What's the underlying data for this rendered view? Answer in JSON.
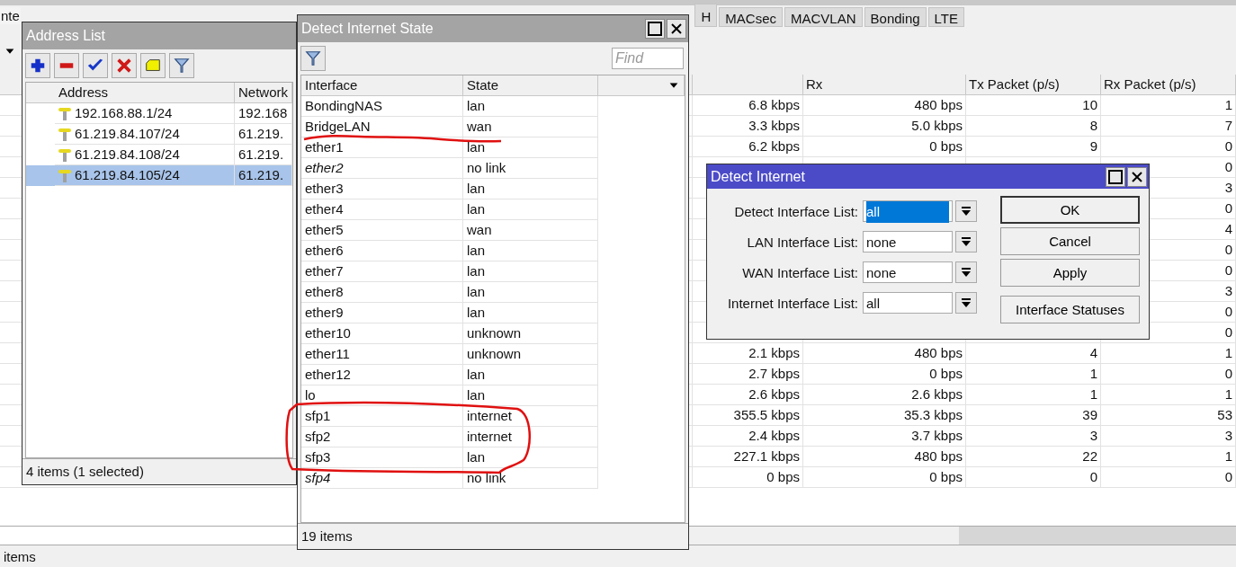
{
  "main_window": {
    "tabs": [
      {
        "label": "nte",
        "selected": true
      },
      {
        "label": "H",
        "selected": false
      },
      {
        "label": "MACsec",
        "selected": false
      },
      {
        "label": "MACVLAN",
        "selected": false
      },
      {
        "label": "Bonding",
        "selected": false
      },
      {
        "label": "LTE",
        "selected": false
      }
    ],
    "table": {
      "columns": [
        "Rx",
        "Tx Packet (p/s)",
        "Rx Packet (p/s)"
      ],
      "rows": [
        {
          "column_1": "6.8 kbps",
          "rx": "480 bps",
          "tx_packet": "10",
          "rx_packet": "1"
        },
        {
          "column_1": "3.3 kbps",
          "rx": "5.0 kbps",
          "tx_packet": "8",
          "rx_packet": "7"
        },
        {
          "column_1": "6.2 kbps",
          "rx": "0 bps",
          "tx_packet": "9",
          "rx_packet": "0"
        },
        {
          "rx_packet": "0"
        },
        {
          "rx_packet": "3"
        },
        {
          "rx_packet": "0"
        },
        {
          "rx_packet": "4"
        },
        {
          "rx_packet": "0"
        },
        {
          "rx_packet": "0"
        },
        {
          "rx_packet": "3"
        },
        {
          "rx_packet": "0"
        },
        {
          "rx_packet": "0"
        },
        {
          "column_1": "2.1 kbps",
          "rx": "480 bps",
          "tx_packet": "4",
          "rx_packet": "1"
        },
        {
          "column_1": "2.7 kbps",
          "rx": "0 bps",
          "tx_packet": "1",
          "rx_packet": "0"
        },
        {
          "column_1": "2.6 kbps",
          "rx": "2.6 kbps",
          "tx_packet": "1",
          "rx_packet": "1"
        },
        {
          "column_1": "355.5 kbps",
          "rx": "35.3 kbps",
          "tx_packet": "39",
          "rx_packet": "53"
        },
        {
          "column_1": "2.4 kbps",
          "rx": "3.7 kbps",
          "tx_packet": "3",
          "rx_packet": "3"
        },
        {
          "column_1": "227.1 kbps",
          "rx": "480 bps",
          "tx_packet": "22",
          "rx_packet": "1"
        },
        {
          "column_1": "0 bps",
          "rx": "0 bps",
          "tx_packet": "0",
          "rx_packet": "0"
        }
      ]
    },
    "status_bar": "items"
  },
  "address_list": {
    "title": "Address List",
    "columns": [
      "Address",
      "Network"
    ],
    "rows": [
      {
        "address": "192.168.88.1/24",
        "network": "192.168",
        "selected": false
      },
      {
        "address": "61.219.84.107/24",
        "network": "61.219.",
        "selected": false
      },
      {
        "address": "61.219.84.108/24",
        "network": "61.219.",
        "selected": false
      },
      {
        "address": "61.219.84.105/24",
        "network": "61.219.",
        "selected": true
      }
    ],
    "status": "4 items (1 selected)"
  },
  "state_window": {
    "title": "Detect Internet State",
    "find_placeholder": "Find",
    "columns": [
      "Interface",
      "State"
    ],
    "rows": [
      {
        "interface": "BondingNAS",
        "state": "lan",
        "inactive": false
      },
      {
        "interface": "BridgeLAN",
        "state": "wan",
        "inactive": false
      },
      {
        "interface": "ether1",
        "state": "lan",
        "inactive": false
      },
      {
        "interface": "ether2",
        "state": "no link",
        "inactive": true
      },
      {
        "interface": "ether3",
        "state": "lan",
        "inactive": false
      },
      {
        "interface": "ether4",
        "state": "lan",
        "inactive": false
      },
      {
        "interface": "ether5",
        "state": "wan",
        "inactive": false
      },
      {
        "interface": "ether6",
        "state": "lan",
        "inactive": false
      },
      {
        "interface": "ether7",
        "state": "lan",
        "inactive": false
      },
      {
        "interface": "ether8",
        "state": "lan",
        "inactive": false
      },
      {
        "interface": "ether9",
        "state": "lan",
        "inactive": false
      },
      {
        "interface": "ether10",
        "state": "unknown",
        "inactive": false
      },
      {
        "interface": "ether11",
        "state": "unknown",
        "inactive": false
      },
      {
        "interface": "ether12",
        "state": "lan",
        "inactive": false
      },
      {
        "interface": "lo",
        "state": "lan",
        "inactive": false
      },
      {
        "interface": "sfp1",
        "state": "internet",
        "inactive": false
      },
      {
        "interface": "sfp2",
        "state": "internet",
        "inactive": false
      },
      {
        "interface": "sfp3",
        "state": "lan",
        "inactive": false
      },
      {
        "interface": "sfp4",
        "state": "no link",
        "inactive": true
      }
    ],
    "status": "19 items"
  },
  "dialog": {
    "title": "Detect Internet",
    "fields": [
      {
        "label": "Detect Interface List:",
        "value": "all",
        "selected": true
      },
      {
        "label": "LAN Interface List:",
        "value": "none",
        "selected": false
      },
      {
        "label": "WAN Interface List:",
        "value": "none",
        "selected": false
      },
      {
        "label": "Internet Interface List:",
        "value": "all",
        "selected": false
      }
    ],
    "buttons": [
      {
        "label": "OK",
        "focused": true
      },
      {
        "label": "Cancel",
        "focused": false
      },
      {
        "label": "Apply",
        "focused": false
      },
      {
        "label": "Interface Statuses",
        "focused": false
      }
    ]
  }
}
